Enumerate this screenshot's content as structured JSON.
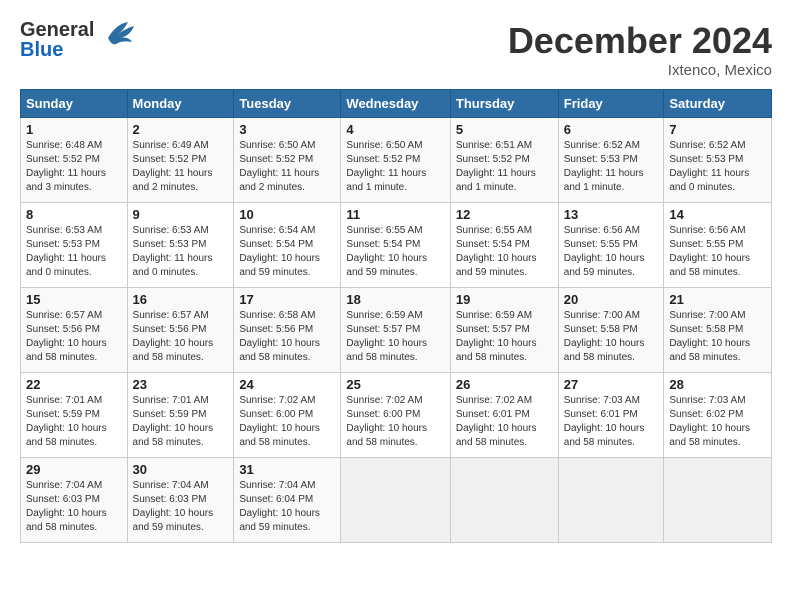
{
  "header": {
    "logo_general": "General",
    "logo_blue": "Blue",
    "month_title": "December 2024",
    "location": "Ixtenco, Mexico"
  },
  "calendar": {
    "days_of_week": [
      "Sunday",
      "Monday",
      "Tuesday",
      "Wednesday",
      "Thursday",
      "Friday",
      "Saturday"
    ],
    "weeks": [
      [
        {
          "day": "",
          "empty": true
        },
        {
          "day": "",
          "empty": true
        },
        {
          "day": "",
          "empty": true
        },
        {
          "day": "",
          "empty": true
        },
        {
          "day": "",
          "empty": true
        },
        {
          "day": "",
          "empty": true
        },
        {
          "day": "",
          "empty": true
        }
      ],
      [
        {
          "day": "1",
          "sunrise": "6:48 AM",
          "sunset": "5:52 PM",
          "daylight": "11 hours and 3 minutes."
        },
        {
          "day": "2",
          "sunrise": "6:49 AM",
          "sunset": "5:52 PM",
          "daylight": "11 hours and 2 minutes."
        },
        {
          "day": "3",
          "sunrise": "6:50 AM",
          "sunset": "5:52 PM",
          "daylight": "11 hours and 2 minutes."
        },
        {
          "day": "4",
          "sunrise": "6:50 AM",
          "sunset": "5:52 PM",
          "daylight": "11 hours and 1 minute."
        },
        {
          "day": "5",
          "sunrise": "6:51 AM",
          "sunset": "5:52 PM",
          "daylight": "11 hours and 1 minute."
        },
        {
          "day": "6",
          "sunrise": "6:52 AM",
          "sunset": "5:53 PM",
          "daylight": "11 hours and 1 minute."
        },
        {
          "day": "7",
          "sunrise": "6:52 AM",
          "sunset": "5:53 PM",
          "daylight": "11 hours and 0 minutes."
        }
      ],
      [
        {
          "day": "8",
          "sunrise": "6:53 AM",
          "sunset": "5:53 PM",
          "daylight": "11 hours and 0 minutes."
        },
        {
          "day": "9",
          "sunrise": "6:53 AM",
          "sunset": "5:53 PM",
          "daylight": "11 hours and 0 minutes."
        },
        {
          "day": "10",
          "sunrise": "6:54 AM",
          "sunset": "5:54 PM",
          "daylight": "10 hours and 59 minutes."
        },
        {
          "day": "11",
          "sunrise": "6:55 AM",
          "sunset": "5:54 PM",
          "daylight": "10 hours and 59 minutes."
        },
        {
          "day": "12",
          "sunrise": "6:55 AM",
          "sunset": "5:54 PM",
          "daylight": "10 hours and 59 minutes."
        },
        {
          "day": "13",
          "sunrise": "6:56 AM",
          "sunset": "5:55 PM",
          "daylight": "10 hours and 59 minutes."
        },
        {
          "day": "14",
          "sunrise": "6:56 AM",
          "sunset": "5:55 PM",
          "daylight": "10 hours and 58 minutes."
        }
      ],
      [
        {
          "day": "15",
          "sunrise": "6:57 AM",
          "sunset": "5:56 PM",
          "daylight": "10 hours and 58 minutes."
        },
        {
          "day": "16",
          "sunrise": "6:57 AM",
          "sunset": "5:56 PM",
          "daylight": "10 hours and 58 minutes."
        },
        {
          "day": "17",
          "sunrise": "6:58 AM",
          "sunset": "5:56 PM",
          "daylight": "10 hours and 58 minutes."
        },
        {
          "day": "18",
          "sunrise": "6:59 AM",
          "sunset": "5:57 PM",
          "daylight": "10 hours and 58 minutes."
        },
        {
          "day": "19",
          "sunrise": "6:59 AM",
          "sunset": "5:57 PM",
          "daylight": "10 hours and 58 minutes."
        },
        {
          "day": "20",
          "sunrise": "7:00 AM",
          "sunset": "5:58 PM",
          "daylight": "10 hours and 58 minutes."
        },
        {
          "day": "21",
          "sunrise": "7:00 AM",
          "sunset": "5:58 PM",
          "daylight": "10 hours and 58 minutes."
        }
      ],
      [
        {
          "day": "22",
          "sunrise": "7:01 AM",
          "sunset": "5:59 PM",
          "daylight": "10 hours and 58 minutes."
        },
        {
          "day": "23",
          "sunrise": "7:01 AM",
          "sunset": "5:59 PM",
          "daylight": "10 hours and 58 minutes."
        },
        {
          "day": "24",
          "sunrise": "7:02 AM",
          "sunset": "6:00 PM",
          "daylight": "10 hours and 58 minutes."
        },
        {
          "day": "25",
          "sunrise": "7:02 AM",
          "sunset": "6:00 PM",
          "daylight": "10 hours and 58 minutes."
        },
        {
          "day": "26",
          "sunrise": "7:02 AM",
          "sunset": "6:01 PM",
          "daylight": "10 hours and 58 minutes."
        },
        {
          "day": "27",
          "sunrise": "7:03 AM",
          "sunset": "6:01 PM",
          "daylight": "10 hours and 58 minutes."
        },
        {
          "day": "28",
          "sunrise": "7:03 AM",
          "sunset": "6:02 PM",
          "daylight": "10 hours and 58 minutes."
        }
      ],
      [
        {
          "day": "29",
          "sunrise": "7:04 AM",
          "sunset": "6:03 PM",
          "daylight": "10 hours and 58 minutes."
        },
        {
          "day": "30",
          "sunrise": "7:04 AM",
          "sunset": "6:03 PM",
          "daylight": "10 hours and 59 minutes."
        },
        {
          "day": "31",
          "sunrise": "7:04 AM",
          "sunset": "6:04 PM",
          "daylight": "10 hours and 59 minutes."
        },
        {
          "day": "",
          "empty": true
        },
        {
          "day": "",
          "empty": true
        },
        {
          "day": "",
          "empty": true
        },
        {
          "day": "",
          "empty": true
        }
      ]
    ]
  }
}
